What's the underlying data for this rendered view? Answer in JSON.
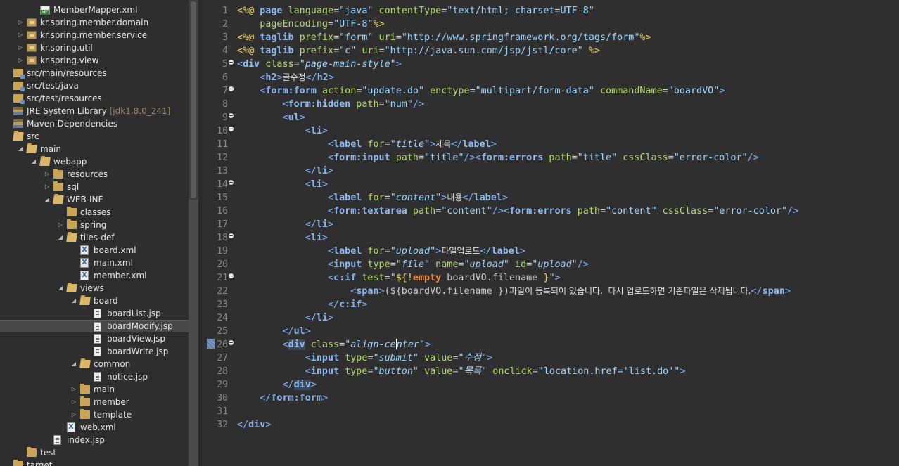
{
  "explorer": {
    "items": [
      {
        "label": "MemberMapper.xml",
        "icon": "mapper-xml-icon",
        "indent": 2,
        "twisty": ""
      },
      {
        "label": "kr.spring.member.domain",
        "icon": "package-icon",
        "indent": 1,
        "twisty": "closed"
      },
      {
        "label": "kr.spring.member.service",
        "icon": "package-icon",
        "indent": 1,
        "twisty": "closed"
      },
      {
        "label": "kr.spring.util",
        "icon": "package-icon",
        "indent": 1,
        "twisty": "closed"
      },
      {
        "label": "kr.spring.view",
        "icon": "package-icon",
        "indent": 1,
        "twisty": "closed"
      },
      {
        "label": "src/main/resources",
        "icon": "source-folder-icon",
        "indent": 0,
        "twisty": ""
      },
      {
        "label": "src/test/java",
        "icon": "source-folder-icon",
        "indent": 0,
        "twisty": ""
      },
      {
        "label": "src/test/resources",
        "icon": "source-folder-icon",
        "indent": 0,
        "twisty": ""
      },
      {
        "label": "JRE System Library",
        "deco": "[jdk1.8.0_241]",
        "icon": "library-icon",
        "indent": 0,
        "twisty": ""
      },
      {
        "label": "Maven Dependencies",
        "icon": "library-icon",
        "indent": 0,
        "twisty": ""
      },
      {
        "label": "src",
        "icon": "folder-open-icon",
        "indent": 0,
        "twisty": ""
      },
      {
        "label": "main",
        "icon": "folder-open-icon",
        "indent": 1,
        "twisty": "open"
      },
      {
        "label": "webapp",
        "icon": "folder-open-icon",
        "indent": 2,
        "twisty": "open"
      },
      {
        "label": "resources",
        "icon": "folder-icon",
        "indent": 3,
        "twisty": "closed"
      },
      {
        "label": "sql",
        "icon": "folder-icon",
        "indent": 3,
        "twisty": "closed"
      },
      {
        "label": "WEB-INF",
        "icon": "folder-open-icon",
        "indent": 3,
        "twisty": "open"
      },
      {
        "label": "classes",
        "icon": "folder-icon",
        "indent": 4,
        "twisty": ""
      },
      {
        "label": "spring",
        "icon": "folder-icon",
        "indent": 4,
        "twisty": "closed"
      },
      {
        "label": "tiles-def",
        "icon": "folder-open-icon",
        "indent": 4,
        "twisty": "open"
      },
      {
        "label": "board.xml",
        "icon": "xml-file-icon",
        "indent": 5,
        "twisty": ""
      },
      {
        "label": "main.xml",
        "icon": "xml-file-icon",
        "indent": 5,
        "twisty": ""
      },
      {
        "label": "member.xml",
        "icon": "xml-file-icon",
        "indent": 5,
        "twisty": ""
      },
      {
        "label": "views",
        "icon": "folder-open-icon",
        "indent": 4,
        "twisty": "open"
      },
      {
        "label": "board",
        "icon": "folder-open-icon",
        "indent": 5,
        "twisty": "open"
      },
      {
        "label": "boardList.jsp",
        "icon": "jsp-file-icon",
        "indent": 6,
        "twisty": ""
      },
      {
        "label": "boardModify.jsp",
        "icon": "jsp-file-icon",
        "indent": 6,
        "twisty": "",
        "selected": true
      },
      {
        "label": "boardView.jsp",
        "icon": "jsp-file-icon",
        "indent": 6,
        "twisty": ""
      },
      {
        "label": "boardWrite.jsp",
        "icon": "jsp-file-icon",
        "indent": 6,
        "twisty": ""
      },
      {
        "label": "common",
        "icon": "folder-open-icon",
        "indent": 5,
        "twisty": "open"
      },
      {
        "label": "notice.jsp",
        "icon": "jsp-file-icon",
        "indent": 6,
        "twisty": ""
      },
      {
        "label": "main",
        "icon": "folder-icon",
        "indent": 5,
        "twisty": "closed"
      },
      {
        "label": "member",
        "icon": "folder-icon",
        "indent": 5,
        "twisty": "closed"
      },
      {
        "label": "template",
        "icon": "folder-icon",
        "indent": 5,
        "twisty": "closed"
      },
      {
        "label": "web.xml",
        "icon": "xml-file-icon",
        "indent": 4,
        "twisty": ""
      },
      {
        "label": "index.jsp",
        "icon": "jsp-file-icon",
        "indent": 3,
        "twisty": ""
      },
      {
        "label": "test",
        "icon": "folder-icon",
        "indent": 1,
        "twisty": ""
      },
      {
        "label": "target",
        "icon": "folder-icon",
        "indent": 0,
        "twisty": ""
      }
    ]
  },
  "editor": {
    "fold_lines": [
      5,
      7,
      9,
      10,
      14,
      18,
      21,
      26
    ],
    "current_line": 26,
    "lines": [
      [
        [
          "k",
          "<%@ "
        ],
        [
          "tn",
          "page"
        ],
        [
          "a",
          " language"
        ],
        [
          "t",
          "="
        ],
        [
          "v",
          "\"java\""
        ],
        [
          "a",
          " contentType"
        ],
        [
          "t",
          "="
        ],
        [
          "v",
          "\"text/html; charset=UTF-8\""
        ]
      ],
      [
        [
          "a",
          "    pageEncoding"
        ],
        [
          "t",
          "="
        ],
        [
          "v",
          "\"UTF-8\""
        ],
        [
          "k",
          "%>"
        ]
      ],
      [
        [
          "k",
          "<%@ "
        ],
        [
          "tn",
          "taglib"
        ],
        [
          "a",
          " prefix"
        ],
        [
          "t",
          "="
        ],
        [
          "v",
          "\"form\""
        ],
        [
          "a",
          " uri"
        ],
        [
          "t",
          "="
        ],
        [
          "v",
          "\"http://www.springframework.org/tags/form\""
        ],
        [
          "k",
          "%>"
        ]
      ],
      [
        [
          "k",
          "<%@ "
        ],
        [
          "tn",
          "taglib"
        ],
        [
          "a",
          " prefix"
        ],
        [
          "t",
          "="
        ],
        [
          "v",
          "\"c\""
        ],
        [
          "a",
          " uri"
        ],
        [
          "t",
          "="
        ],
        [
          "v",
          "\"http://java.sun.com/jsp/jstl/core\""
        ],
        [
          "k",
          " %>"
        ]
      ],
      [
        [
          "n",
          "<"
        ],
        [
          "tn",
          "div"
        ],
        [
          "a",
          " class"
        ],
        [
          "t",
          "="
        ],
        [
          "vi",
          "\"page-main-style\""
        ],
        [
          "n",
          ">"
        ]
      ],
      [
        [
          "t",
          "    "
        ],
        [
          "n",
          "<"
        ],
        [
          "tn",
          "h2"
        ],
        [
          "n",
          ">"
        ],
        [
          "kor",
          "글수정"
        ],
        [
          "n",
          "</"
        ],
        [
          "tn",
          "h2"
        ],
        [
          "n",
          ">"
        ]
      ],
      [
        [
          "t",
          "    "
        ],
        [
          "n",
          "<"
        ],
        [
          "tn",
          "form:form"
        ],
        [
          "a",
          " action"
        ],
        [
          "t",
          "="
        ],
        [
          "v",
          "\"update.do\""
        ],
        [
          "a",
          " enctype"
        ],
        [
          "t",
          "="
        ],
        [
          "v",
          "\"multipart/form-data\""
        ],
        [
          "a",
          " commandName"
        ],
        [
          "t",
          "="
        ],
        [
          "v",
          "\"boardVO\""
        ],
        [
          "n",
          ">"
        ]
      ],
      [
        [
          "t",
          "        "
        ],
        [
          "n",
          "<"
        ],
        [
          "tn",
          "form:hidden"
        ],
        [
          "a",
          " path"
        ],
        [
          "t",
          "="
        ],
        [
          "v",
          "\"num\""
        ],
        [
          "n",
          "/>"
        ]
      ],
      [
        [
          "t",
          "        "
        ],
        [
          "n",
          "<"
        ],
        [
          "tn",
          "ul"
        ],
        [
          "n",
          ">"
        ]
      ],
      [
        [
          "t",
          "            "
        ],
        [
          "n",
          "<"
        ],
        [
          "tn",
          "li"
        ],
        [
          "n",
          ">"
        ]
      ],
      [
        [
          "t",
          "                "
        ],
        [
          "n",
          "<"
        ],
        [
          "tn",
          "label"
        ],
        [
          "a",
          " for"
        ],
        [
          "t",
          "="
        ],
        [
          "vi",
          "\"title\""
        ],
        [
          "n",
          ">"
        ],
        [
          "kor",
          "제목"
        ],
        [
          "n",
          "</"
        ],
        [
          "tn",
          "label"
        ],
        [
          "n",
          ">"
        ]
      ],
      [
        [
          "t",
          "                "
        ],
        [
          "n",
          "<"
        ],
        [
          "tn",
          "form:input"
        ],
        [
          "a",
          " path"
        ],
        [
          "t",
          "="
        ],
        [
          "v",
          "\"title\""
        ],
        [
          "n",
          "/><"
        ],
        [
          "tn",
          "form:errors"
        ],
        [
          "a",
          " path"
        ],
        [
          "t",
          "="
        ],
        [
          "v",
          "\"title\""
        ],
        [
          "a",
          " cssClass"
        ],
        [
          "t",
          "="
        ],
        [
          "v",
          "\"error-color\""
        ],
        [
          "n",
          "/>"
        ]
      ],
      [
        [
          "t",
          "            "
        ],
        [
          "n",
          "</"
        ],
        [
          "tn",
          "li"
        ],
        [
          "n",
          ">"
        ]
      ],
      [
        [
          "t",
          "            "
        ],
        [
          "n",
          "<"
        ],
        [
          "tn",
          "li"
        ],
        [
          "n",
          ">"
        ]
      ],
      [
        [
          "t",
          "                "
        ],
        [
          "n",
          "<"
        ],
        [
          "tn",
          "label"
        ],
        [
          "a",
          " for"
        ],
        [
          "t",
          "="
        ],
        [
          "vi",
          "\"content\""
        ],
        [
          "n",
          ">"
        ],
        [
          "kor",
          "내용"
        ],
        [
          "n",
          "</"
        ],
        [
          "tn",
          "label"
        ],
        [
          "n",
          ">"
        ]
      ],
      [
        [
          "t",
          "                "
        ],
        [
          "n",
          "<"
        ],
        [
          "tn",
          "form:textarea"
        ],
        [
          "a",
          " path"
        ],
        [
          "t",
          "="
        ],
        [
          "v",
          "\"content\""
        ],
        [
          "n",
          "/><"
        ],
        [
          "tn",
          "form:errors"
        ],
        [
          "a",
          " path"
        ],
        [
          "t",
          "="
        ],
        [
          "v",
          "\"content\""
        ],
        [
          "a",
          " cssClass"
        ],
        [
          "t",
          "="
        ],
        [
          "v",
          "\"error-color\""
        ],
        [
          "n",
          "/>"
        ]
      ],
      [
        [
          "t",
          "            "
        ],
        [
          "n",
          "</"
        ],
        [
          "tn",
          "li"
        ],
        [
          "n",
          ">"
        ]
      ],
      [
        [
          "t",
          "            "
        ],
        [
          "n",
          "<"
        ],
        [
          "tn",
          "li"
        ],
        [
          "n",
          ">"
        ]
      ],
      [
        [
          "t",
          "                "
        ],
        [
          "n",
          "<"
        ],
        [
          "tn",
          "label"
        ],
        [
          "a",
          " for"
        ],
        [
          "t",
          "="
        ],
        [
          "vi",
          "\"upload\""
        ],
        [
          "n",
          ">"
        ],
        [
          "kor",
          "파일업로드"
        ],
        [
          "n",
          "</"
        ],
        [
          "tn",
          "label"
        ],
        [
          "n",
          ">"
        ]
      ],
      [
        [
          "t",
          "                "
        ],
        [
          "n",
          "<"
        ],
        [
          "tn",
          "input"
        ],
        [
          "a",
          " type"
        ],
        [
          "t",
          "="
        ],
        [
          "vi",
          "\"file\""
        ],
        [
          "a",
          " name"
        ],
        [
          "t",
          "="
        ],
        [
          "vi",
          "\"upload\""
        ],
        [
          "a",
          " id"
        ],
        [
          "t",
          "="
        ],
        [
          "vi",
          "\"upload\""
        ],
        [
          "n",
          "/>"
        ]
      ],
      [
        [
          "t",
          "                "
        ],
        [
          "n",
          "<"
        ],
        [
          "tn",
          "c:if"
        ],
        [
          "a",
          " test"
        ],
        [
          "t",
          "="
        ],
        [
          "v",
          "\""
        ],
        [
          "el",
          "${!"
        ],
        [
          "kw",
          "empty"
        ],
        [
          "t",
          " boardVO.filename "
        ],
        [
          "el",
          "}"
        ],
        [
          "v",
          "\""
        ],
        [
          "n",
          ">"
        ]
      ],
      [
        [
          "t",
          "                    "
        ],
        [
          "n",
          "<"
        ],
        [
          "tn",
          "span"
        ],
        [
          "n",
          ">"
        ],
        [
          "t",
          "(${boardVO.filename })"
        ],
        [
          "kor",
          "파일이 등록되어 있습니다.  다시 업로드하면 기존파일은 삭제됩니다."
        ],
        [
          "n",
          "</"
        ],
        [
          "tn",
          "span"
        ],
        [
          "n",
          ">"
        ]
      ],
      [
        [
          "t",
          "                "
        ],
        [
          "n",
          "</"
        ],
        [
          "tn",
          "c:if"
        ],
        [
          "n",
          ">"
        ]
      ],
      [
        [
          "t",
          "            "
        ],
        [
          "n",
          "</"
        ],
        [
          "tn",
          "li"
        ],
        [
          "n",
          ">"
        ]
      ],
      [
        [
          "t",
          "        "
        ],
        [
          "n",
          "</"
        ],
        [
          "tn",
          "ul"
        ],
        [
          "n",
          ">"
        ]
      ],
      [
        [
          "t",
          "        "
        ],
        [
          "n",
          "<"
        ],
        [
          "hl",
          "div"
        ],
        [
          "a",
          " class"
        ],
        [
          "t",
          "="
        ],
        [
          "vi",
          "\"align-ce"
        ],
        [
          "caret",
          ""
        ],
        [
          "vi",
          "nter\""
        ],
        [
          "n",
          ">"
        ]
      ],
      [
        [
          "t",
          "            "
        ],
        [
          "n",
          "<"
        ],
        [
          "tn",
          "input"
        ],
        [
          "a",
          " type"
        ],
        [
          "t",
          "="
        ],
        [
          "vi",
          "\"submit\""
        ],
        [
          "a",
          " value"
        ],
        [
          "t",
          "="
        ],
        [
          "vi",
          "\"수정\""
        ],
        [
          "n",
          ">"
        ]
      ],
      [
        [
          "t",
          "            "
        ],
        [
          "n",
          "<"
        ],
        [
          "tn",
          "input"
        ],
        [
          "a",
          " type"
        ],
        [
          "t",
          "="
        ],
        [
          "vi",
          "\"button\""
        ],
        [
          "a",
          " value"
        ],
        [
          "t",
          "="
        ],
        [
          "vi",
          "\"목록\""
        ],
        [
          "a",
          " onclick"
        ],
        [
          "t",
          "="
        ],
        [
          "v",
          "\"location.href='list.do'\""
        ],
        [
          "n",
          ">"
        ]
      ],
      [
        [
          "t",
          "        "
        ],
        [
          "n",
          "</"
        ],
        [
          "hl",
          "div"
        ],
        [
          "n",
          ">"
        ]
      ],
      [
        [
          "t",
          "    "
        ],
        [
          "n",
          "</"
        ],
        [
          "tn",
          "form:form"
        ],
        [
          "n",
          ">"
        ]
      ],
      [],
      [
        [
          "n",
          "</"
        ],
        [
          "tn",
          "div"
        ],
        [
          "n",
          ">"
        ]
      ]
    ]
  },
  "colors": {
    "background": "#2f2f2f",
    "explorer_background": "#2e2e2e",
    "selection": "#474747",
    "attribute": "#b5da6e",
    "value": "#9fd6ff",
    "tag": "#8db8f0",
    "directive": "#e8d46b"
  }
}
